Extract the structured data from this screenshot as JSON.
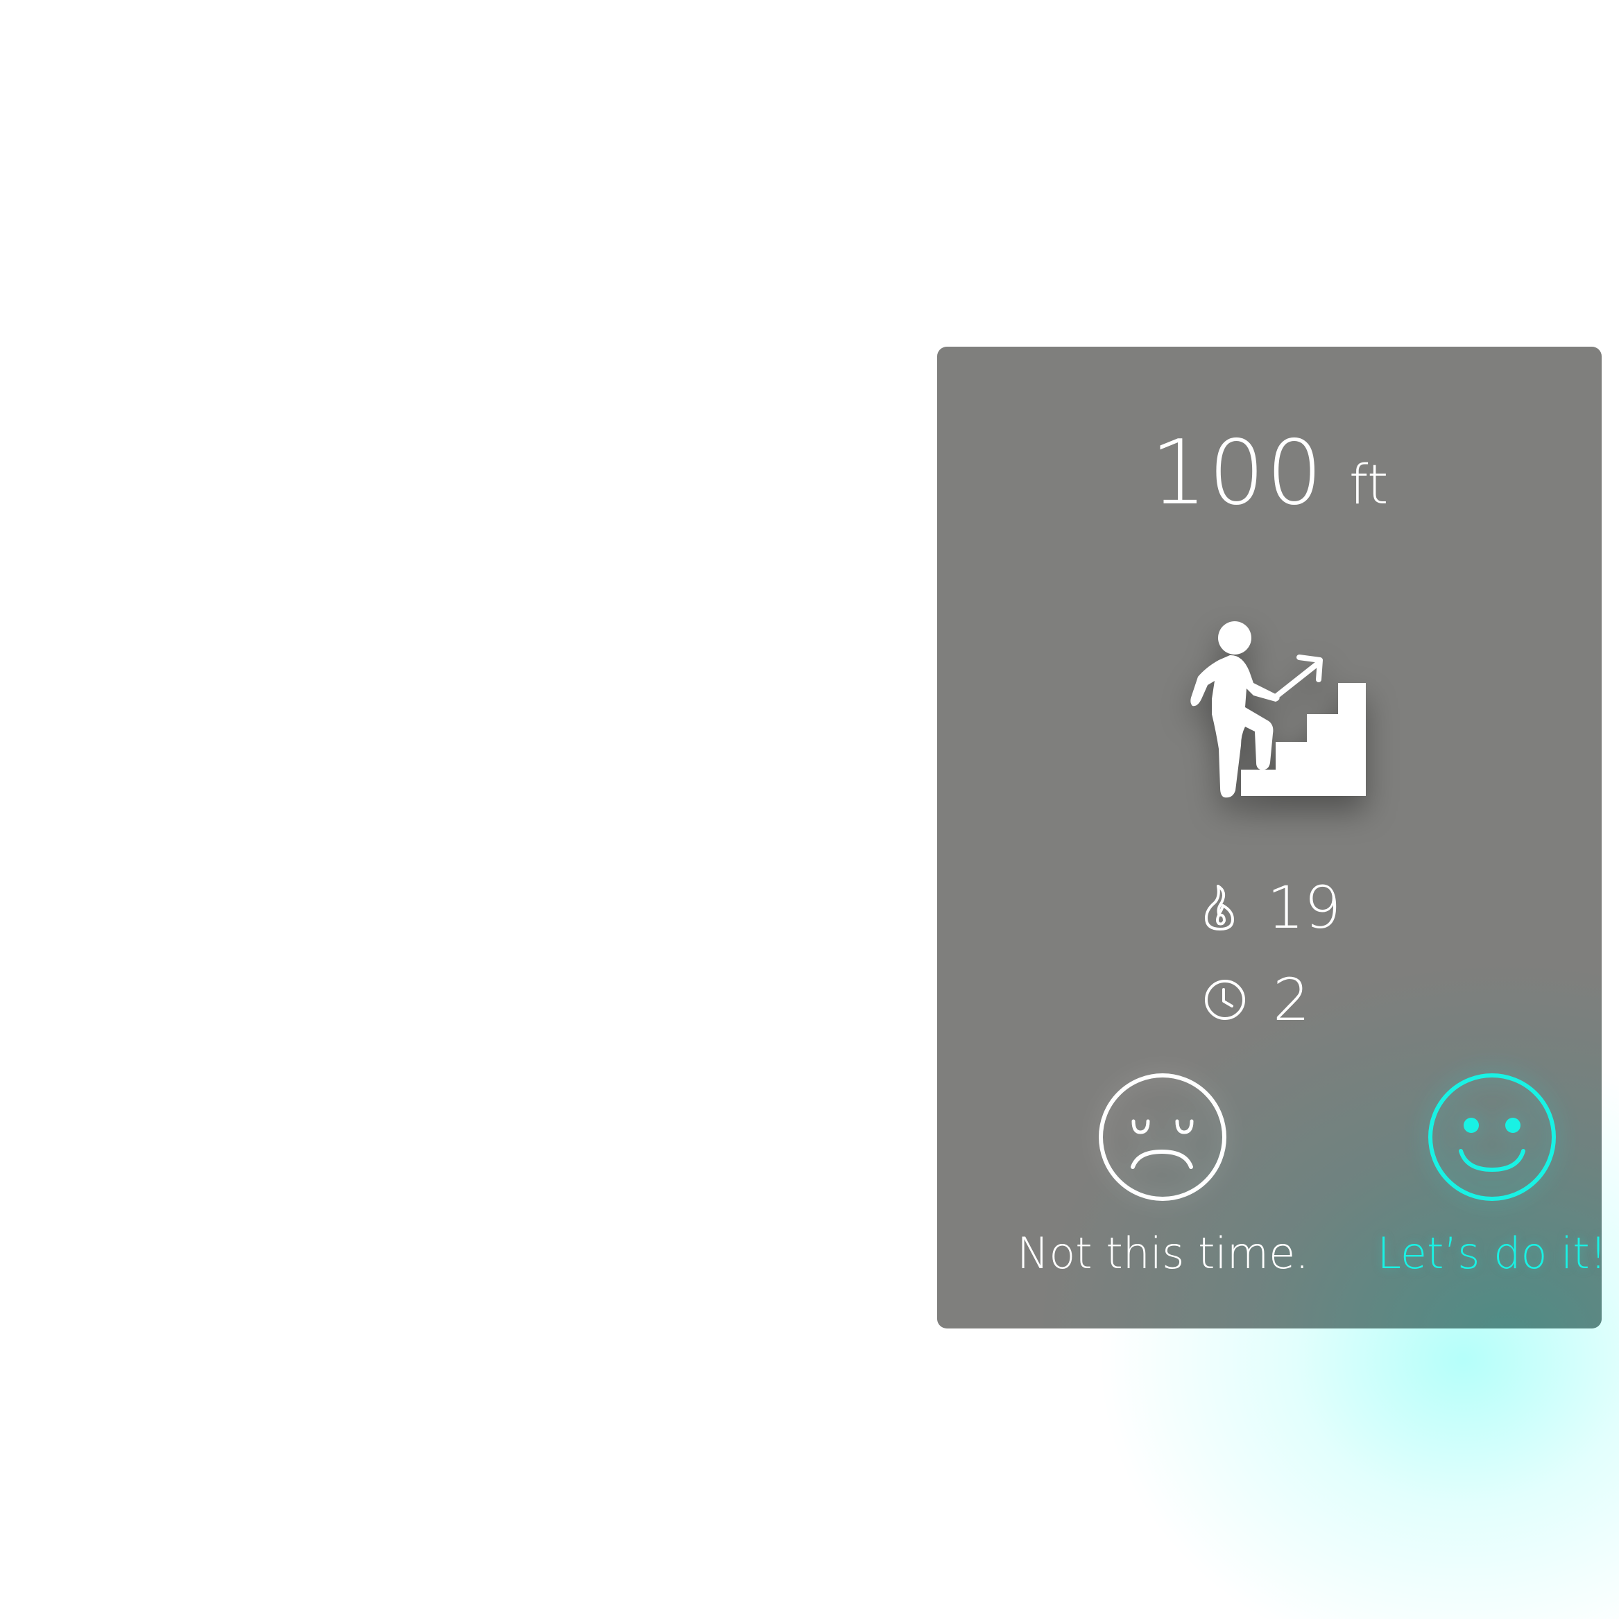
{
  "workout": {
    "distance_value": "100",
    "distance_unit": "ft",
    "activity_icon": "stair-climb-icon",
    "calories_icon": "flame-icon",
    "calories": "19",
    "time_icon": "clock-icon",
    "minutes": "2"
  },
  "actions": {
    "decline_label": "Not this time.",
    "decline_icon": "sad-face-icon",
    "accept_label": "Let’s do it!",
    "accept_icon": "happy-face-icon"
  },
  "colors": {
    "card_background": "#7f7f7d",
    "accent": "#19f2e4",
    "text": "#ffffff"
  }
}
